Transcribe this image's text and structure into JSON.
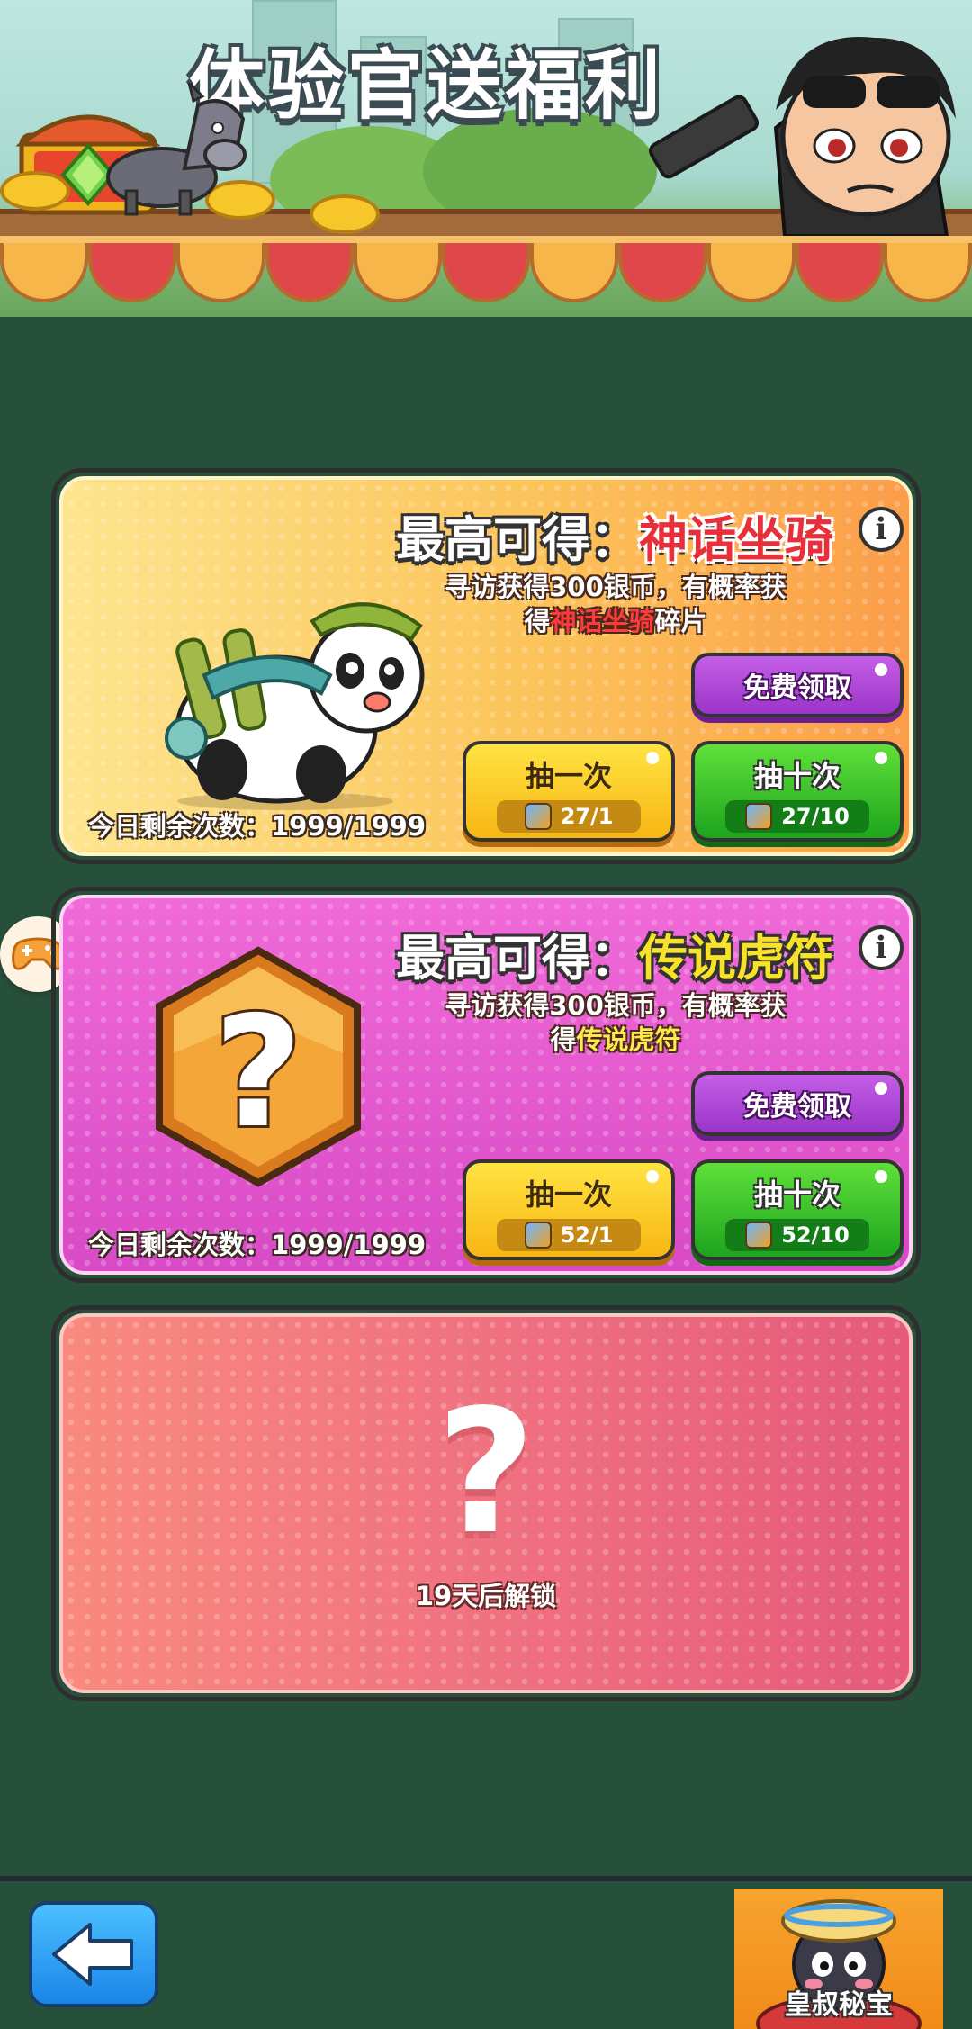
{
  "header": {
    "title": "体验官送福利"
  },
  "cards": [
    {
      "best_label": "最高可得：",
      "best_value": "神话坐骑",
      "desc_line1": "寻访获得300银币，有概率获",
      "desc_prefix": "得",
      "desc_highlight": "神话坐骑",
      "desc_suffix": "碎片",
      "free_button": "免费领取",
      "draw_one_label": "抽一次",
      "draw_one_cost": "27/1",
      "draw_ten_label": "抽十次",
      "draw_ten_cost": "27/10",
      "remaining": "今日剩余次数：1999/1999"
    },
    {
      "best_label": "最高可得：",
      "best_value": "传说虎符",
      "desc_line1": "寻访获得300银币，有概率获",
      "desc_prefix": "得",
      "desc_highlight": "传说虎符",
      "free_button": "免费领取",
      "draw_one_label": "抽一次",
      "draw_one_cost": "52/1",
      "draw_ten_label": "抽十次",
      "draw_ten_cost": "52/10",
      "remaining": "今日剩余次数：1999/1999"
    },
    {
      "locked_symbol": "?",
      "unlock_text": "19天后解锁"
    }
  ],
  "bottom": {
    "treasure_label": "皇叔秘宝"
  },
  "colors": {
    "page_bg": "#27503b",
    "highlight_red": "#e8303a",
    "highlight_yellow": "#f8e12a",
    "free_btn": "#9b34c8",
    "one_btn": "#f8b614",
    "ten_btn": "#1ea41e",
    "back_btn": "#1a86e8"
  },
  "icons": {
    "info": "info-icon",
    "ticket": "ticket-icon",
    "back": "back-arrow-icon",
    "gamepad": "gamepad-icon"
  }
}
